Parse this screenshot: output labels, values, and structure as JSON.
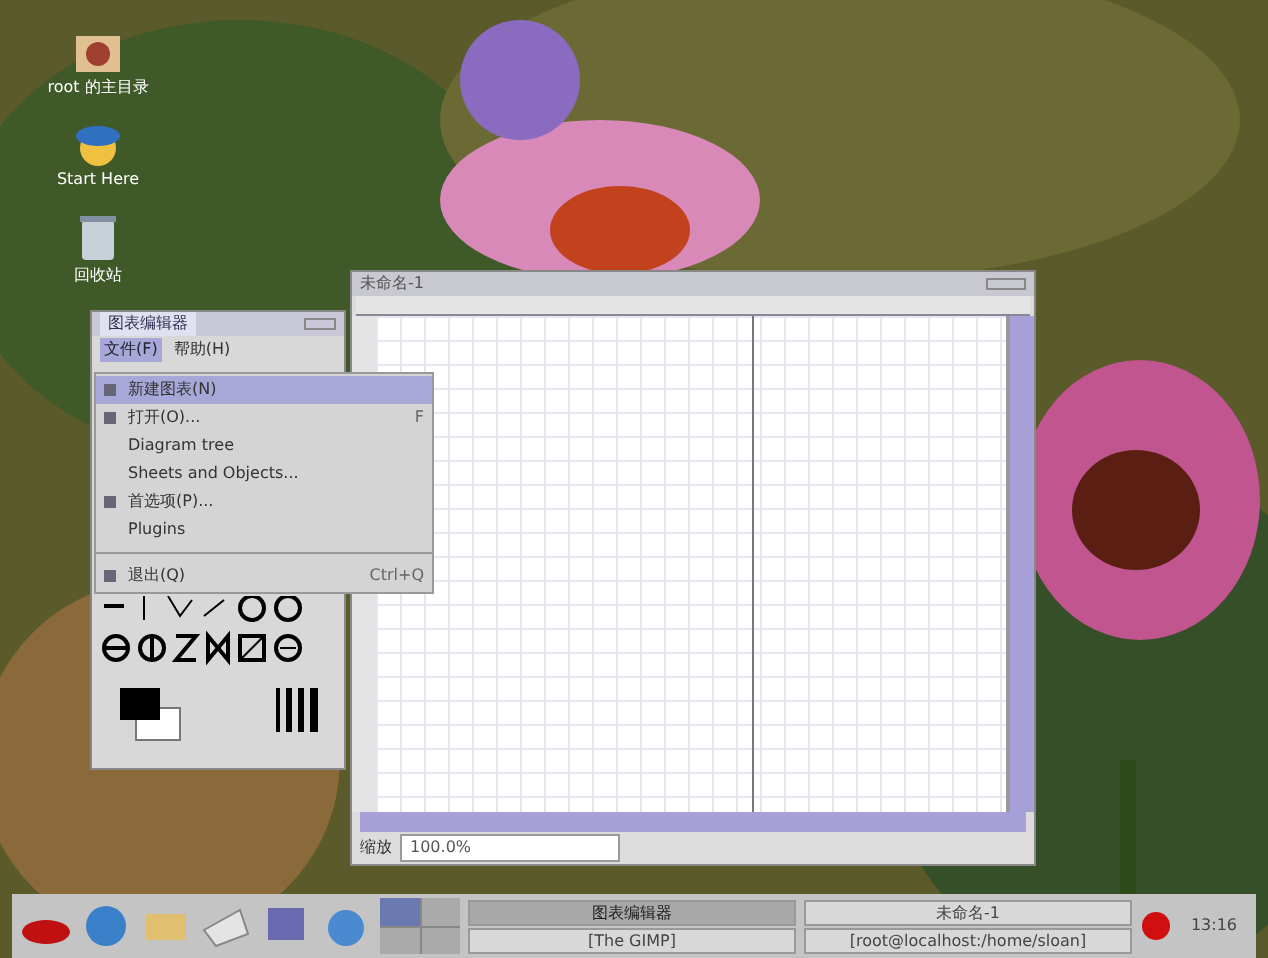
{
  "desktop_icons": [
    {
      "label": "root 的主目录"
    },
    {
      "label": "Start Here"
    },
    {
      "label": "回收站"
    }
  ],
  "toolbox": {
    "title": "图表编辑器",
    "menus": [
      {
        "label": "文件(F)",
        "selected": true
      },
      {
        "label": "帮助(H)",
        "selected": false
      }
    ]
  },
  "file_menu": [
    {
      "label": "新建图表(N)",
      "icon": true,
      "selected": true
    },
    {
      "label": "打开(O)...",
      "shortcut": "F",
      "icon": true,
      "selected": false
    },
    {
      "label": "Diagram tree",
      "icon": false,
      "selected": false
    },
    {
      "label": "Sheets and Objects...",
      "icon": false,
      "selected": false
    },
    {
      "label": "首选项(P)...",
      "icon": true,
      "selected": false
    },
    {
      "label": "Plugins",
      "icon": false,
      "selected": false
    },
    {
      "label": "退出(Q)",
      "shortcut": "Ctrl+Q",
      "icon": true,
      "selected": false,
      "separator_before": true
    }
  ],
  "diagram_window": {
    "title": "未命名-1",
    "zoom_label": "缩放",
    "zoom": "100.0%"
  },
  "taskbar": {
    "tasks": [
      {
        "label": "图表编辑器",
        "selected": true
      },
      {
        "label": "未命名-1",
        "selected": false
      },
      {
        "label": "[The GIMP]",
        "selected": false
      },
      {
        "label": "[root@localhost:/home/sloan]",
        "selected": false
      }
    ],
    "clock": "13:16"
  }
}
